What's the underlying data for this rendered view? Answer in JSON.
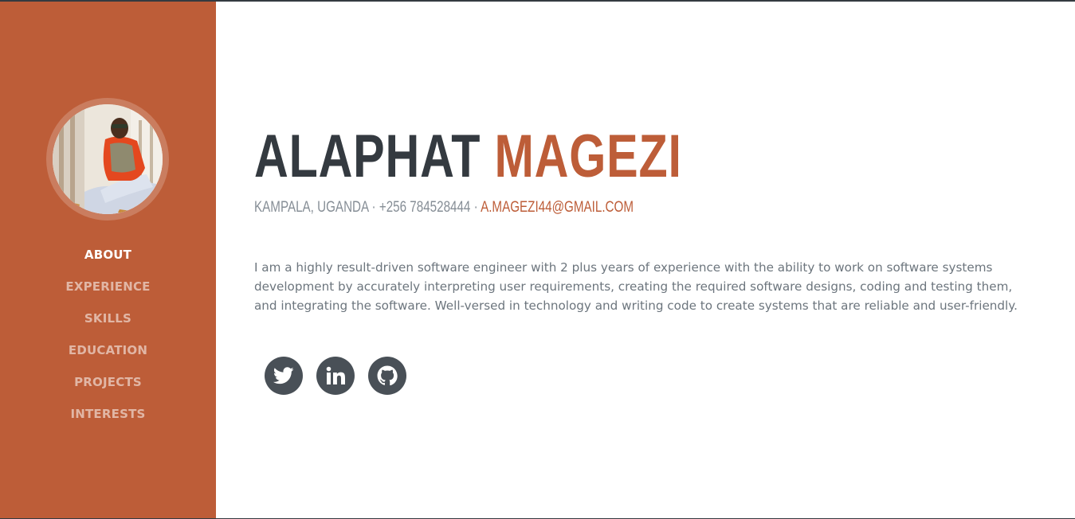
{
  "colors": {
    "sidebar_bg": "#bd5d38",
    "accent": "#bd5d38",
    "heading_dark": "#343a40",
    "muted_text": "#6c757d",
    "social_bg": "#495057"
  },
  "sidebar": {
    "avatar_alt": "profile photo",
    "nav": [
      {
        "label": "ABOUT",
        "active": true
      },
      {
        "label": "EXPERIENCE",
        "active": false
      },
      {
        "label": "SKILLS",
        "active": false
      },
      {
        "label": "EDUCATION",
        "active": false
      },
      {
        "label": "PROJECTS",
        "active": false
      },
      {
        "label": "INTERESTS",
        "active": false
      }
    ]
  },
  "about": {
    "first_name": "ALAPHAT",
    "last_name": "MAGEZI",
    "location": "KAMPALA, UGANDA",
    "separator": " · ",
    "phone": "+256 784528444",
    "email": "A.MAGEZI44@GMAIL.COM",
    "lead": "I am a highly result-driven software engineer with 2 plus years of experience with the ability to work on software systems development by accurately interpreting user requirements, creating the required software designs, coding and testing them, and integrating the software. Well-versed in technology and writing code to create systems that are reliable and user-friendly."
  },
  "social": [
    {
      "name": "twitter-icon"
    },
    {
      "name": "linkedin-icon"
    },
    {
      "name": "github-icon"
    }
  ]
}
